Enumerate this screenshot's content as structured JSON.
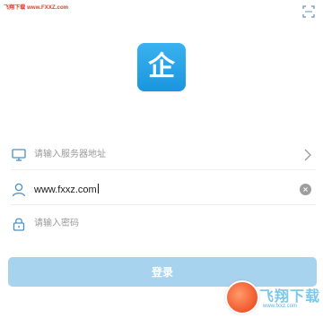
{
  "watermark": {
    "top_text": "飞翔下载 www.FXXZ.com"
  },
  "header": {
    "scan_icon": "scan-icon"
  },
  "logo": {
    "glyph": "企",
    "color": "#2aa3ea"
  },
  "form": {
    "server": {
      "placeholder": "请输入服务器地址",
      "icon": "monitor-icon",
      "action_icon": "chevron-right-icon"
    },
    "username": {
      "value": "www.fxxz.com",
      "icon": "user-icon",
      "action_icon": "clear-icon",
      "clear_glyph": "×"
    },
    "password": {
      "placeholder": "请输入密码",
      "icon": "lock-icon"
    }
  },
  "login_button": {
    "label": "登录",
    "color": "#a8d3ef"
  },
  "corner_watermark": {
    "brand": "飞翔下载",
    "site": "www.fxxz.com"
  }
}
